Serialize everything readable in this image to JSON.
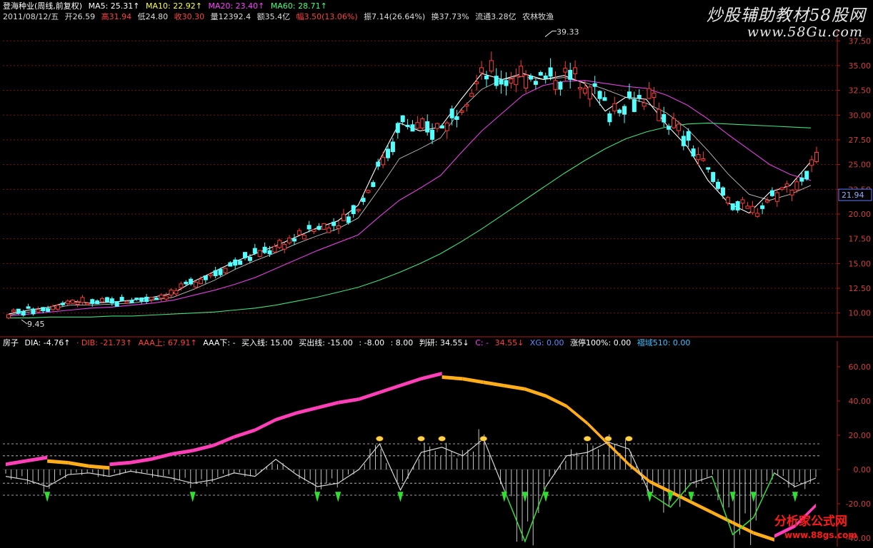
{
  "header": {
    "title": "登海种业(周线,前复权)",
    "ma5": "MA5: 25.31↑",
    "ma10": "MA10: 22.92↑",
    "ma20": "MA20: 23.40↑",
    "ma60": "MA60: 28.71↑",
    "date": "2011/08/12/五",
    "open": "开26.59",
    "high": "高31.94",
    "low": "低24.80",
    "close": "收30.30",
    "volume": "量12392.4",
    "amount": "额35.4亿",
    "change": "幅3.50(13.06%)",
    "amplitude": "振7.14(26.64%)",
    "turnover": "换37.73%",
    "float": "流通3.28亿",
    "sector": "农林牧渔"
  },
  "indicator_header": {
    "name": "房子",
    "dia": "DIA: -4.76↑",
    "dib": "· DIB: -21.73↑",
    "aaa_up": "AAA上: 67.91↑",
    "aaa_down": "AAA下: -",
    "buy_line": "买入线: 15.00",
    "sell_line": "买出线: -15.00",
    "c1": ": -8.00",
    "c2": ": 8.00",
    "judge": "判研: 34.55↓",
    "c3": "C: -",
    "c4": "34.55↓",
    "xg": "XG: 0.00",
    "limit_up": "涨停100%: 0.00",
    "pyramid": "褶域510: 0.00"
  },
  "watermarks": {
    "top": "炒股辅助教材58股网",
    "top_url": "www.58Gu.com",
    "bottom": "分析家公式网",
    "bottom_url": "www.88gs.com"
  },
  "colors": {
    "up": "#ff3b3b",
    "down": "#54ffff",
    "ma5": "#ffffff",
    "ma10": "#e6e600",
    "ma20": "#e040e0",
    "ma60": "#40e080",
    "band_pink": "#ff3fb8",
    "band_orange": "#ffae1a",
    "dia_line": "#d8d8d8",
    "green_low": "#30e030",
    "axis": "#b01a1a"
  },
  "chart_data": [
    {
      "type": "candlestick",
      "title": "登海种业(周线,前复权)",
      "ylim": [
        7.6,
        38.6
      ],
      "y_ticks": [
        "37.50",
        "35.00",
        "32.50",
        "30.00",
        "27.50",
        "25.00",
        "22.50",
        "20.00",
        "17.50",
        "15.00",
        "12.50",
        "10.00"
      ],
      "current_price_label": "21.94",
      "annotations": {
        "high": "39.33",
        "low": "9.45"
      },
      "series": [
        {
          "name": "MA5",
          "values": [
            9.9,
            10.3,
            10.6,
            11.2,
            11.0,
            11.1,
            11.3,
            11.6,
            12.0,
            13.2,
            14.2,
            15.2,
            16.0,
            16.8,
            17.7,
            18.6,
            19.3,
            20.9,
            25.3,
            29.2,
            28.4,
            28.8,
            31.6,
            34.2,
            33.6,
            34.2,
            33.6,
            34.0,
            33.2,
            30.4,
            31.8,
            31.6,
            29.0,
            26.8,
            23.4,
            21.1,
            20.1,
            22.2,
            22.9,
            25.3
          ]
        },
        {
          "name": "MA10",
          "values": [
            9.8,
            10.1,
            10.4,
            10.8,
            10.8,
            10.9,
            11.0,
            11.3,
            11.6,
            12.4,
            13.3,
            14.4,
            15.3,
            16.1,
            17.0,
            17.8,
            18.5,
            19.6,
            22.5,
            25.6,
            26.6,
            27.7,
            30.6,
            32.6,
            33.6,
            33.9,
            33.6,
            33.8,
            33.3,
            32.6,
            31.8,
            31.2,
            30.2,
            28.6,
            26.4,
            24.0,
            22.0,
            21.4,
            22.0,
            22.9
          ]
        },
        {
          "name": "MA20",
          "values": [
            9.7,
            9.9,
            10.1,
            10.3,
            10.5,
            10.6,
            10.8,
            11.0,
            11.3,
            11.8,
            12.3,
            12.9,
            13.6,
            14.5,
            15.4,
            16.3,
            17.1,
            17.9,
            19.7,
            21.4,
            22.6,
            23.9,
            26.2,
            28.4,
            30.2,
            32.0,
            33.0,
            33.4,
            33.5,
            33.2,
            32.9,
            32.7,
            32.0,
            31.0,
            29.6,
            28.0,
            26.5,
            25.0,
            24.0,
            23.4
          ]
        },
        {
          "name": "MA60",
          "values": [
            9.5,
            9.5,
            9.6,
            9.6,
            9.6,
            9.7,
            9.7,
            9.8,
            9.9,
            10.0,
            10.1,
            10.3,
            10.5,
            10.8,
            11.2,
            11.6,
            12.1,
            12.6,
            13.3,
            14.1,
            15.0,
            16.0,
            17.2,
            18.5,
            19.9,
            21.3,
            22.7,
            24.1,
            25.4,
            26.6,
            27.6,
            28.3,
            28.8,
            29.1,
            29.2,
            29.1,
            29.0,
            28.9,
            28.8,
            28.7
          ]
        }
      ]
    },
    {
      "type": "line",
      "title": "房子",
      "ylim": [
        -45,
        70
      ],
      "y_ticks": [
        "60.00",
        "40.00",
        "20.00",
        "0.00",
        "-20.00",
        "-40.00"
      ],
      "reference_lines": [
        15,
        8,
        -8,
        -15
      ],
      "series": [
        {
          "name": "DIA",
          "values": [
            -4,
            -6,
            -10,
            -3,
            -2,
            -4,
            -1,
            -3,
            -5,
            -8,
            -6,
            -2,
            -4,
            6,
            -3,
            -10,
            -8,
            0,
            15,
            -12,
            10,
            13,
            8,
            18,
            -12,
            -42,
            -10,
            8,
            10,
            16,
            12,
            -14,
            -22,
            -8,
            -4,
            -38,
            -28,
            -2,
            -10,
            -5
          ]
        },
        {
          "name": "DIB",
          "values": [
            2,
            4,
            6,
            5,
            3,
            2,
            3,
            5,
            8,
            10,
            13,
            18,
            22,
            28,
            32,
            35,
            38,
            40,
            44,
            48,
            52,
            55,
            54,
            52,
            50,
            48,
            44,
            38,
            28,
            16,
            4,
            -6,
            -12,
            -18,
            -24,
            -30,
            -36,
            -40,
            -34,
            -22
          ]
        }
      ]
    }
  ]
}
